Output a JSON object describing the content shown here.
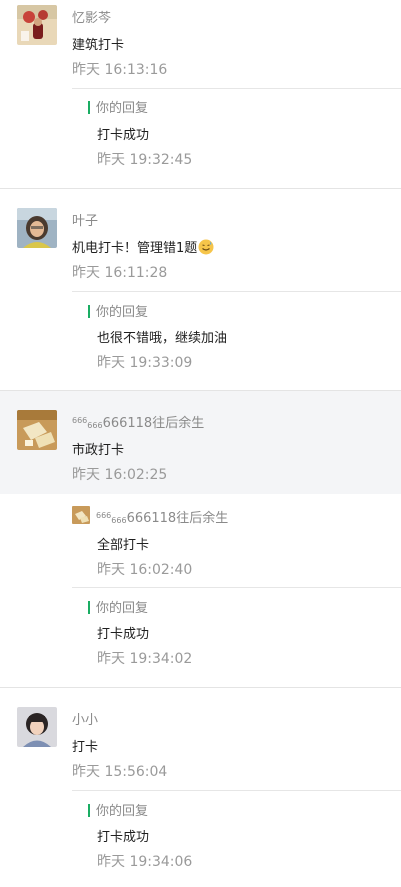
{
  "messages": [
    {
      "name": "忆影芩",
      "content": "建筑打卡",
      "time": "昨天 16:13:16",
      "avatar_icon": "avatar-icon",
      "reply": {
        "label": "你的回复",
        "text": "打卡成功",
        "time": "昨天 19:32:45"
      }
    },
    {
      "name": "叶子",
      "content": "机电打卡！管理错1题",
      "content_emoji": "sweat-smile-emoji-icon",
      "time": "昨天 16:11:28",
      "avatar_icon": "avatar-icon",
      "reply": {
        "label": "你的回复",
        "text": "也很不错哦，继续加油",
        "time": "昨天 19:33:09"
      }
    },
    {
      "name_sup": "666",
      "name_sub": "666",
      "name_rest": "666118往后余生",
      "content": "市政打卡",
      "time": "昨天 16:02:25",
      "avatar_icon": "avatar-icon",
      "sub_message": {
        "name_sup": "666",
        "name_sub": "666",
        "name_rest": "666118往后余生",
        "text": "全部打卡",
        "time": "昨天 16:02:40"
      },
      "reply": {
        "label": "你的回复",
        "text": "打卡成功",
        "time": "昨天 19:34:02"
      }
    },
    {
      "name": "小小",
      "content": "打卡",
      "time": "昨天 15:56:04",
      "avatar_icon": "avatar-icon",
      "reply": {
        "label": "你的回复",
        "text": "打卡成功",
        "time": "昨天 19:34:06"
      }
    }
  ],
  "colors": {
    "reply_bar": "#1aad63",
    "highlight_bg": "#f4f5f7",
    "meta_text": "#9a9a9a"
  }
}
